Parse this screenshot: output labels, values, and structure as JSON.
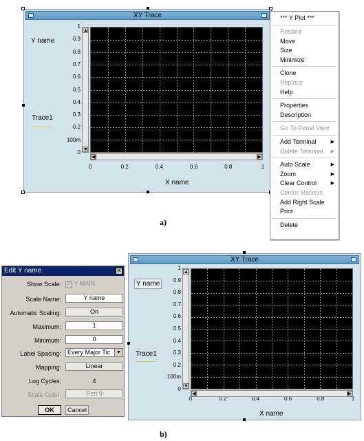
{
  "panel_a": {
    "title": "XY Trace",
    "y_name": "Y name",
    "x_name": "X name",
    "trace_label": "Trace1",
    "y_ticks": [
      "1",
      "0.9",
      "0.8",
      "0.7",
      "0.6",
      "0.5",
      "0.4",
      "0.3",
      "0.2",
      "100m",
      "0"
    ],
    "x_ticks": [
      "0",
      "0.2",
      "0.4",
      "0.6",
      "0.8",
      "1"
    ],
    "caption": "a)"
  },
  "context_menu": {
    "header": "*** Y Plot ***",
    "groups": [
      [
        {
          "label": "Restore",
          "disabled": true
        },
        {
          "label": "Move",
          "disabled": false
        },
        {
          "label": "Size",
          "disabled": false
        },
        {
          "label": "Minimize",
          "disabled": false
        }
      ],
      [
        {
          "label": "Clone",
          "disabled": false
        },
        {
          "label": "Replace",
          "disabled": true
        },
        {
          "label": "Help",
          "disabled": false
        }
      ],
      [
        {
          "label": "Properties",
          "disabled": false
        },
        {
          "label": "Description",
          "disabled": false
        }
      ],
      [
        {
          "label": "Go To Panel View",
          "disabled": true
        }
      ],
      [
        {
          "label": "Add Terminal",
          "disabled": false,
          "submenu": true
        },
        {
          "label": "Delete Terminal",
          "disabled": true,
          "submenu": true
        }
      ],
      [
        {
          "label": "Auto Scale",
          "disabled": false,
          "submenu": true
        },
        {
          "label": "Zoom",
          "disabled": false,
          "submenu": true
        },
        {
          "label": "Clear Control",
          "disabled": false,
          "submenu": true
        },
        {
          "label": "Center Markers",
          "disabled": true
        },
        {
          "label": "Add Right Scale",
          "disabled": false
        },
        {
          "label": "Print",
          "disabled": false
        }
      ],
      [
        {
          "label": "Delete",
          "disabled": false
        }
      ]
    ]
  },
  "edit_dialog": {
    "title": "Edit Y name",
    "show_scale_label": "Show Scale:",
    "show_scale_value": "Y MAIN",
    "scale_name_label": "Scale Name:",
    "scale_name_value": "Y name",
    "auto_scaling_label": "Automatic Scaling:",
    "auto_scaling_value": "On",
    "maximum_label": "Maximum:",
    "maximum_value": "1",
    "minimum_label": "Minimum:",
    "minimum_value": "0",
    "label_spacing_label": "Label Spacing:",
    "label_spacing_value": "Every Major Tic",
    "mapping_label": "Mapping:",
    "mapping_value": "Linear",
    "log_cycles_label": "Log Cycles:",
    "log_cycles_value": "4",
    "scale_color_label": "Scale Color:",
    "scale_color_value": "Pen 9",
    "ok_label": "OK",
    "cancel_label": "Cancel"
  },
  "panel_b": {
    "title": "XY Trace",
    "y_name": "Y name",
    "x_name": "X name",
    "trace_label": "Trace1",
    "y_ticks": [
      "1",
      "0.9",
      "0.8",
      "0.7",
      "0.6",
      "0.5",
      "0.4",
      "0.3",
      "0.2",
      "100m",
      "0"
    ],
    "x_ticks": [
      "0",
      "0.2",
      "0.4",
      "0.6",
      "0.8",
      "1"
    ],
    "caption": "b)"
  },
  "colors": {
    "window_bg": "#d3e3ec",
    "titlebar": "#6aa4cf",
    "graph_bg": "#000000",
    "grid": "#8c8c8c",
    "trace": "#d8c74a",
    "dialog_title": "#0a246a"
  }
}
